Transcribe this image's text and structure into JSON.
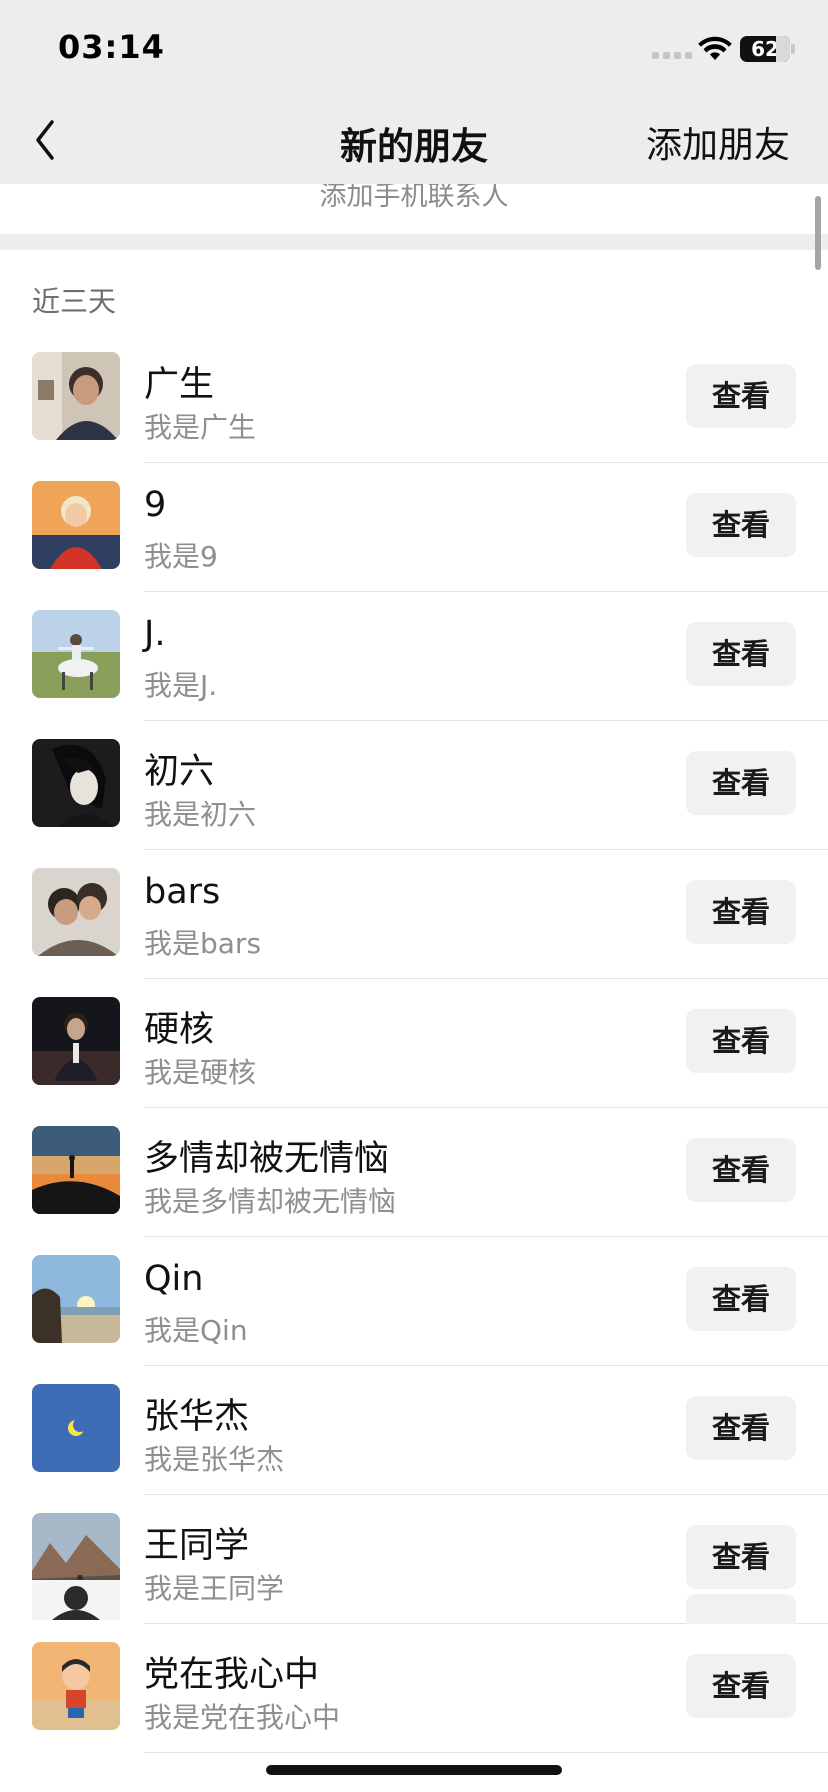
{
  "status_bar": {
    "time": "03:14",
    "battery": "62"
  },
  "nav": {
    "title": "新的朋友",
    "action_label": "添加朋友"
  },
  "add_contacts_label": "添加手机联系人",
  "section_label": "近三天",
  "view_label": "查看",
  "requests": [
    {
      "name": "广生",
      "greeting": "我是广生",
      "avatar": "photo-portrait-man"
    },
    {
      "name": "9",
      "greeting": "我是9",
      "avatar": "photo-child-red"
    },
    {
      "name": "J.",
      "greeting": "我是J.",
      "avatar": "photo-horse-rider"
    },
    {
      "name": "初六",
      "greeting": "我是初六",
      "avatar": "anime-dark-hair"
    },
    {
      "name": "bars",
      "greeting": "我是bars",
      "avatar": "photo-couple"
    },
    {
      "name": "硬核",
      "greeting": "我是硬核",
      "avatar": "photo-suit-man"
    },
    {
      "name": "多情却被无情恼",
      "greeting": "我是多情却被无情恼",
      "avatar": "photo-sunset-silhouette"
    },
    {
      "name": "Qin",
      "greeting": "我是Qin",
      "avatar": "photo-beach-sun"
    },
    {
      "name": "张华杰",
      "greeting": "我是张华杰",
      "avatar": "icon-moon-blue"
    },
    {
      "name": "王同学",
      "greeting": "我是王同学",
      "avatar": "photo-mountain-road"
    },
    {
      "name": "党在我心中",
      "greeting": "我是党在我心中",
      "avatar": "cartoon-boy-sunset"
    }
  ],
  "colors": {
    "header_bg": "#ededed",
    "button_bg": "#f1f1f1",
    "secondary_text": "#8f8f8f"
  }
}
